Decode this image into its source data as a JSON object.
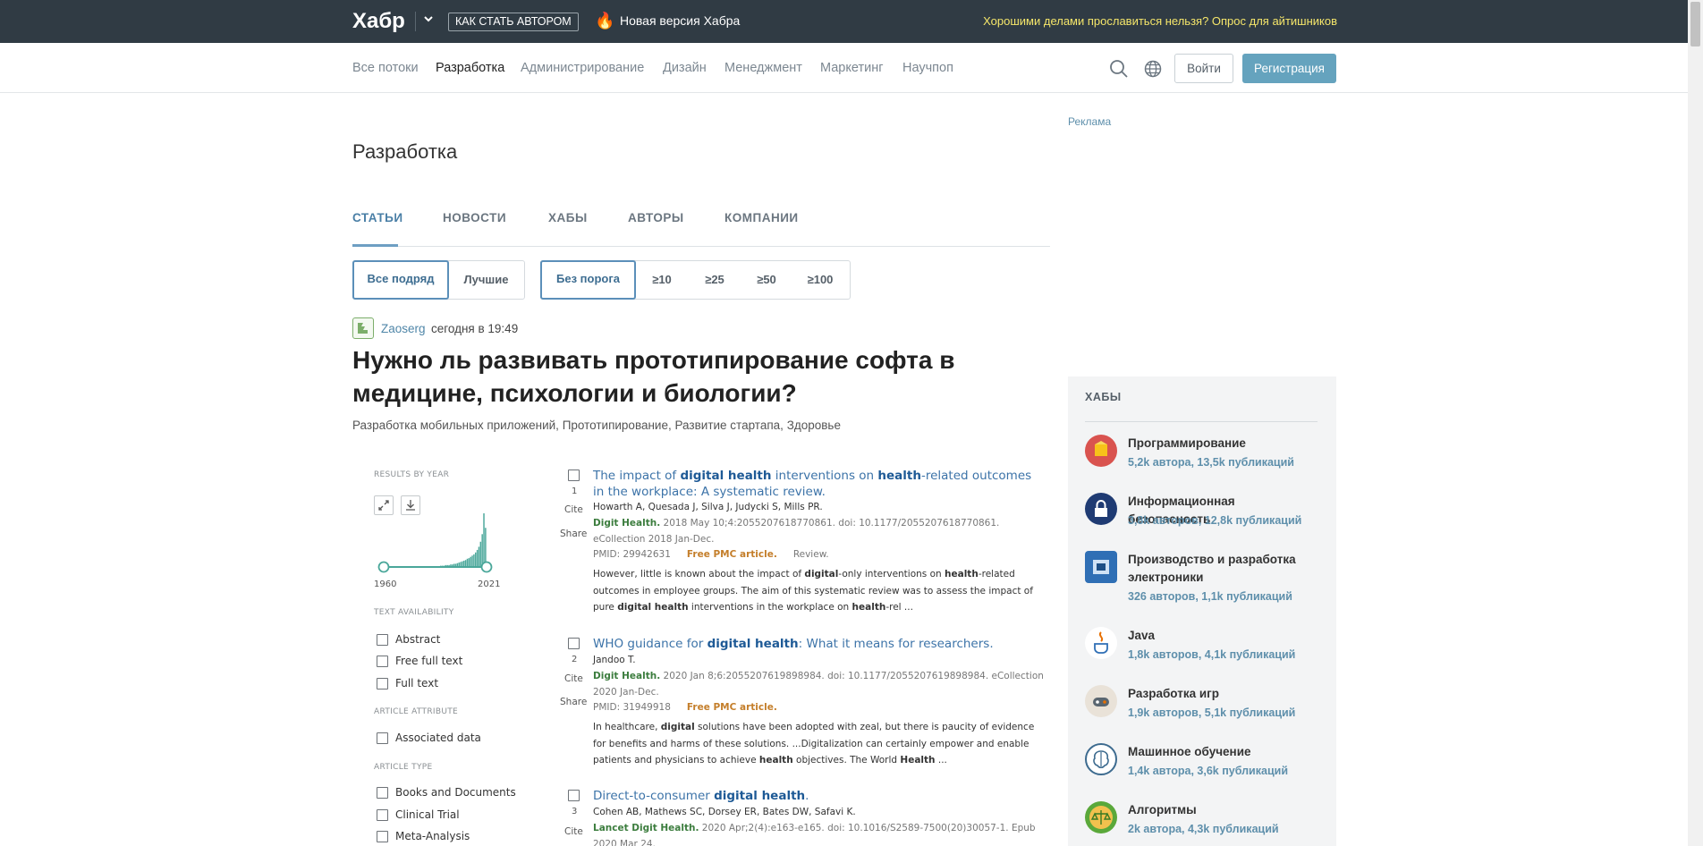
{
  "topbar": {
    "logo": "Хабр",
    "become_author": "КАК СТАТЬ АВТОРОМ",
    "new_version": "Новая версия Хабра",
    "promo": "Хорошими делами прославиться нельзя? Опрос для айтишников"
  },
  "nav": {
    "items": [
      "Все потоки",
      "Разработка",
      "Администрирование",
      "Дизайн",
      "Менеджмент",
      "Маркетинг",
      "Научпоп"
    ],
    "login": "Войти",
    "register": "Регистрация"
  },
  "page": {
    "title": "Разработка",
    "ad_label": "Реклама",
    "tabs": [
      "СТАТЬИ",
      "НОВОСТИ",
      "ХАБЫ",
      "АВТОРЫ",
      "КОМПАНИИ"
    ],
    "filter_sort": [
      "Все подряд",
      "Лучшие"
    ],
    "filter_threshold": [
      "Без порога",
      "≥10",
      "≥25",
      "≥50",
      "≥100"
    ]
  },
  "post": {
    "author": "Zaoserg",
    "time": "сегодня в 19:49",
    "title": "Нужно ль развивать прототипирование софта в медицине, психологии и биологии?",
    "hubs": [
      "Разработка мобильных приложений,",
      "Прототипирование,",
      "Развитие стартапа,",
      "Здоровье"
    ]
  },
  "embed": {
    "results_by_year": "RESULTS BY YEAR",
    "year_start": "1960",
    "year_end": "2021",
    "chart_data": {
      "type": "area",
      "x_range": [
        1960,
        2021
      ],
      "note_values_relative": [
        0,
        0,
        0,
        0,
        0,
        0,
        0,
        0,
        0,
        0,
        0,
        0,
        0,
        0,
        0,
        0,
        0,
        0,
        0,
        0,
        0,
        0,
        0,
        0,
        0,
        0,
        0,
        0,
        0,
        1,
        1,
        1,
        1,
        1,
        2,
        2,
        2,
        3,
        3,
        3,
        4,
        4,
        5,
        5,
        6,
        7,
        8,
        9,
        10,
        11,
        13,
        14,
        16,
        18,
        20,
        23,
        27,
        32,
        40,
        52,
        85,
        62
      ]
    },
    "text_availability": "TEXT AVAILABILITY",
    "text_filters": [
      "Abstract",
      "Free full text",
      "Full text"
    ],
    "article_attribute": "ARTICLE ATTRIBUTE",
    "attr_filters": [
      "Associated data"
    ],
    "article_type": "ARTICLE TYPE",
    "type_filters": [
      "Books and Documents",
      "Clinical Trial",
      "Meta-Analysis"
    ],
    "cite": "Cite",
    "share": "Share",
    "results": [
      {
        "num": "1",
        "authors": "Howarth A, Quesada J, Silva J, Judycki S, Mills PR.",
        "journal": "Digit Health.",
        "citation": " 2018 May 10;4:2055207618770861. doi: 10.1177/2055207618770861. eCollection 2018 Jan-Dec.",
        "pmid": "PMID: 29942631",
        "free": "Free PMC article.",
        "review": "Review."
      },
      {
        "num": "2",
        "authors": "Jandoo T.",
        "journal": "Digit Health.",
        "citation": " 2020 Jan 8;6:2055207619898984. doi: 10.1177/2055207619898984. eCollection 2020 Jan-Dec.",
        "pmid": "PMID: 31949918",
        "free": "Free PMC article."
      },
      {
        "num": "3",
        "authors": "Cohen AB, Mathews SC, Dorsey ER, Bates DW, Safavi K.",
        "journal": "Lancet Digit Health.",
        "citation": " 2020 Apr;2(4):e163-e165. doi: 10.1016/S2589-7500(20)30057-1. Epub 2020 Mar 24."
      }
    ]
  },
  "hubs": {
    "heading": "ХАБЫ",
    "items": [
      {
        "name": "Программирование",
        "stats": "5,2k автора, 13,5k публикаций",
        "color": "#d9534f"
      },
      {
        "name": "Информационная безопасность",
        "stats": "3,8k авторов, 12,8k публикаций",
        "color": "#1f3b73"
      },
      {
        "name": "Производство и разработка электроники",
        "stats": "326 авторов, 1,1k публикаций",
        "color": "#2f6fb5"
      },
      {
        "name": "Java",
        "stats": "1,8k авторов, 4,1k публикаций",
        "color": "#e76f00"
      },
      {
        "name": "Разработка игр",
        "stats": "1,9k авторов, 5,1k публикаций",
        "color": "#e9e2d8"
      },
      {
        "name": "Машинное обучение",
        "stats": "1,4k автора, 3,6k публикаций",
        "color": "#3d6b8f"
      },
      {
        "name": "Алгоритмы",
        "stats": "2k автора, 4,3k публикаций",
        "color": "#5aa83a"
      }
    ]
  }
}
